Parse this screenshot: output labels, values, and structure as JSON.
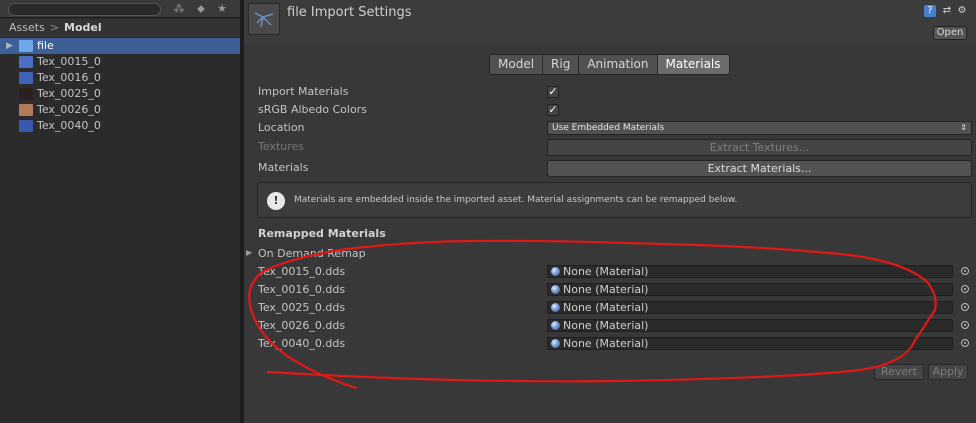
{
  "left_panel": {
    "breadcrumb": {
      "root": "Assets",
      "separator": ">",
      "current": "Model"
    },
    "assets": [
      {
        "label": "file",
        "icon": "model-icon",
        "selected": true,
        "color": "#6fa8e8"
      },
      {
        "label": "Tex_0015_0",
        "icon": "texture-icon",
        "color": "#4a6fc4"
      },
      {
        "label": "Tex_0016_0",
        "icon": "texture-icon",
        "color": "#3f63b8"
      },
      {
        "label": "Tex_0025_0",
        "icon": "texture-icon",
        "color": "#2a2020"
      },
      {
        "label": "Tex_0026_0",
        "icon": "texture-icon",
        "color": "#b07a5c"
      },
      {
        "label": "Tex_0040_0",
        "icon": "texture-icon",
        "color": "#3a58b0"
      }
    ]
  },
  "inspector": {
    "title": "file Import Settings",
    "open_label": "Open",
    "tabs": [
      {
        "label": "Model"
      },
      {
        "label": "Rig"
      },
      {
        "label": "Animation"
      },
      {
        "label": "Materials",
        "active": true
      }
    ],
    "properties": {
      "import_materials": {
        "label": "Import Materials",
        "checked": true,
        "mark": "✓"
      },
      "srgb_albedo": {
        "label": "sRGB Albedo Colors",
        "checked": true,
        "mark": "✓"
      },
      "location": {
        "label": "Location",
        "value": "Use Embedded Materials"
      },
      "textures": {
        "label": "Textures",
        "button": "Extract Textures..."
      },
      "materials": {
        "label": "Materials",
        "button": "Extract Materials..."
      }
    },
    "help_text": "Materials are embedded inside the imported asset. Material assignments can be remapped below.",
    "remapped": {
      "title": "Remapped Materials",
      "on_demand_label": "On Demand Remap",
      "rows": [
        {
          "label": "Tex_0015_0.dds",
          "value": "None (Material)"
        },
        {
          "label": "Tex_0016_0.dds",
          "value": "None (Material)"
        },
        {
          "label": "Tex_0025_0.dds",
          "value": "None (Material)"
        },
        {
          "label": "Tex_0026_0.dds",
          "value": "None (Material)"
        },
        {
          "label": "Tex_0040_0.dds",
          "value": "None (Material)"
        }
      ]
    },
    "buttons": {
      "revert": "Revert",
      "apply": "Apply"
    }
  },
  "colors": {
    "annotation_red": "#e01818",
    "selection_blue": "#3e5f96"
  }
}
